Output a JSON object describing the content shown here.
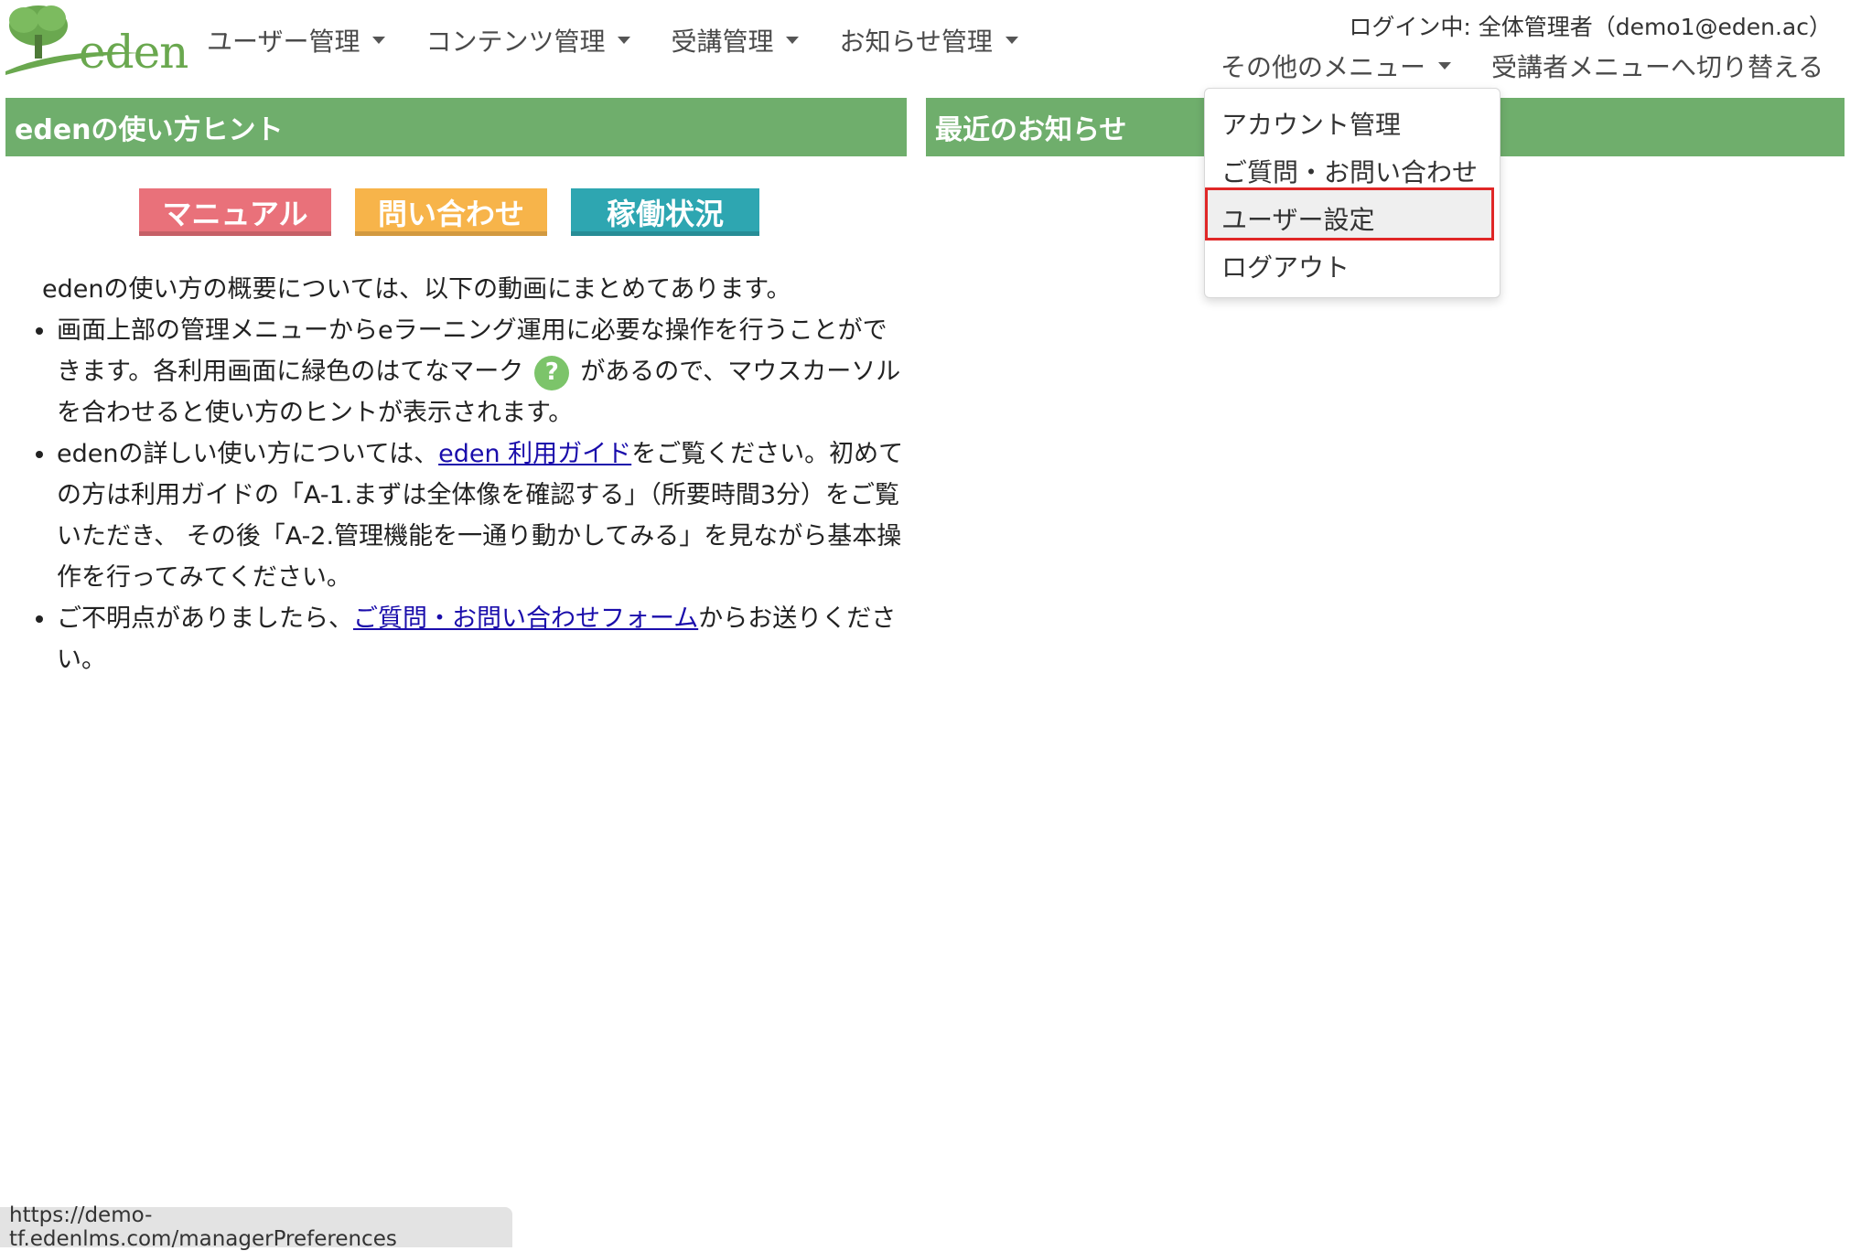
{
  "brand": {
    "logo_text": "eden"
  },
  "nav": {
    "user_mgmt": "ユーザー管理",
    "content_mgmt": "コンテンツ管理",
    "course_mgmt": "受講管理",
    "notice_mgmt": "お知らせ管理",
    "other_menu": "その他のメニュー"
  },
  "header": {
    "login_info": "ログイン中: 全体管理者（demo1@eden.ac）",
    "switch_link": "受講者メニューへ切り替える"
  },
  "dropdown": {
    "items": [
      "アカウント管理",
      "ご質問・お問い合わせ",
      "ユーザー設定",
      "ログアウト"
    ]
  },
  "left_panel": {
    "title": "edenの使い方ヒント",
    "buttons": {
      "manual": "マニュアル",
      "contact": "問い合わせ",
      "status": "稼働状況"
    },
    "intro": "edenの使い方の概要については、以下の動画にまとめてあります。",
    "bullet1_a": "画面上部の管理メニューからeラーニング運用に必要な操作を行うことができます。各利用画面に緑色のはてなマーク",
    "bullet1_b": "があるので、マウスカーソルを合わせると使い方のヒントが表示されます。",
    "help_glyph": "?",
    "bullet2_a": "edenの詳しい使い方については、",
    "bullet2_link": "eden 利用ガイド",
    "bullet2_b": "をご覧ください。初めての方は利用ガイドの「A-1.まずは全体像を確認する」（所要時間3分）をご覧いただき、 その後「A-2.管理機能を一通り動かしてみる」を見ながら基本操作を行ってみてください。",
    "bullet3_a": "ご不明点がありましたら、",
    "bullet3_link": "ご質問・お問い合わせフォーム",
    "bullet3_b": "からお送りください。"
  },
  "right_panel": {
    "title": "最近のお知らせ"
  },
  "status_bar": {
    "url": "https://demo-tf.edenlms.com/managerPreferences"
  },
  "colors": {
    "header_green": "#6fae6c",
    "link_blue": "#1a0dab",
    "highlight_red": "#e02727"
  }
}
